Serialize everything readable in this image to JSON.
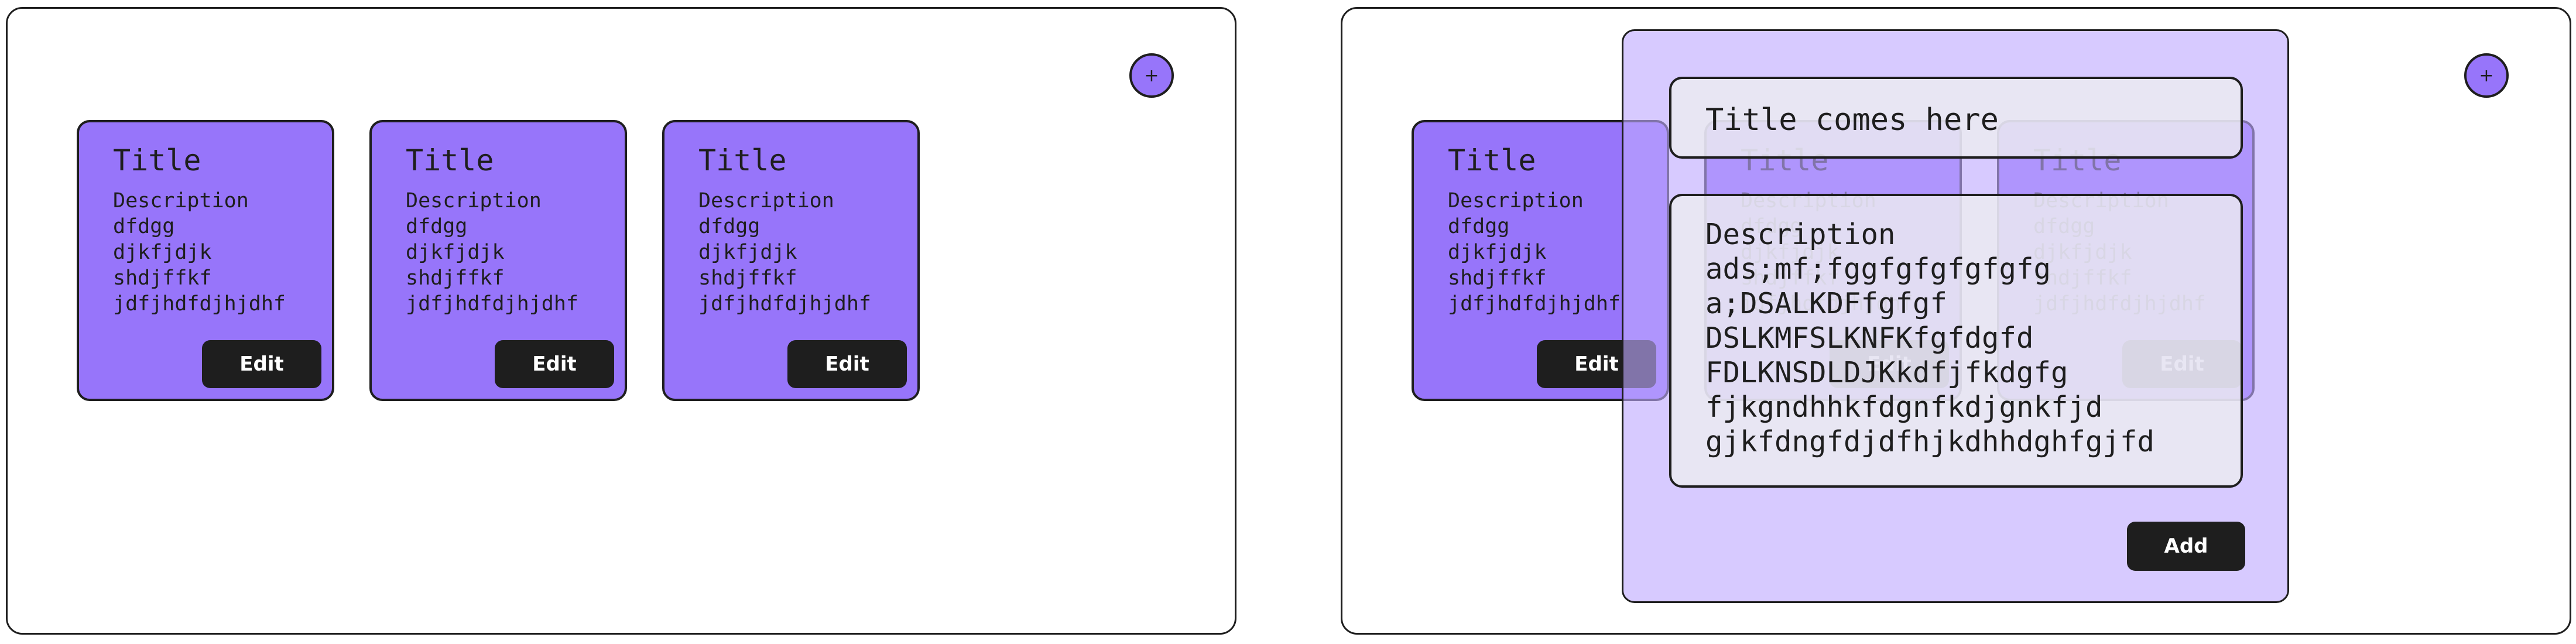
{
  "add_button_label": "+",
  "cards": [
    {
      "title": "Title",
      "description_lines": [
        "Description",
        "dfdgg",
        "djkfjdjk",
        "shdjffkf",
        "jdfjhdfdjhjdhf"
      ],
      "edit_label": "Edit"
    },
    {
      "title": "Title",
      "description_lines": [
        "Description",
        "dfdgg",
        "djkfjdjk",
        "shdjffkf",
        "jdfjhdfdjhjdhf"
      ],
      "edit_label": "Edit"
    },
    {
      "title": "Title",
      "description_lines": [
        "Description",
        "dfdgg",
        "djkfjdjk",
        "shdjffkf",
        "jdfjhdfdjhjdhf"
      ],
      "edit_label": "Edit"
    }
  ],
  "modal": {
    "title_value": "Title comes here",
    "description_lines": [
      "Description",
      "ads;mf;fggfgfgfgfgfg",
      "a;DSALKDFfgfgf",
      "DSLKMFSLKNFKfgfdgfd",
      "FDLKNSDLDJKkdfjfkdgfg",
      "fjkgndhhkfdgnfkdjgnkfjd",
      "gjkfdngfdjdfhjkdhhdghfgjfd"
    ],
    "add_label": "Add"
  },
  "colors": {
    "card_fill": "#9775fa",
    "stroke": "#1e1e1e",
    "modal_fill": "#beaaff",
    "field_fill": "#ececf0",
    "button_fill": "#1e1e1e",
    "button_text": "#ffffff"
  }
}
